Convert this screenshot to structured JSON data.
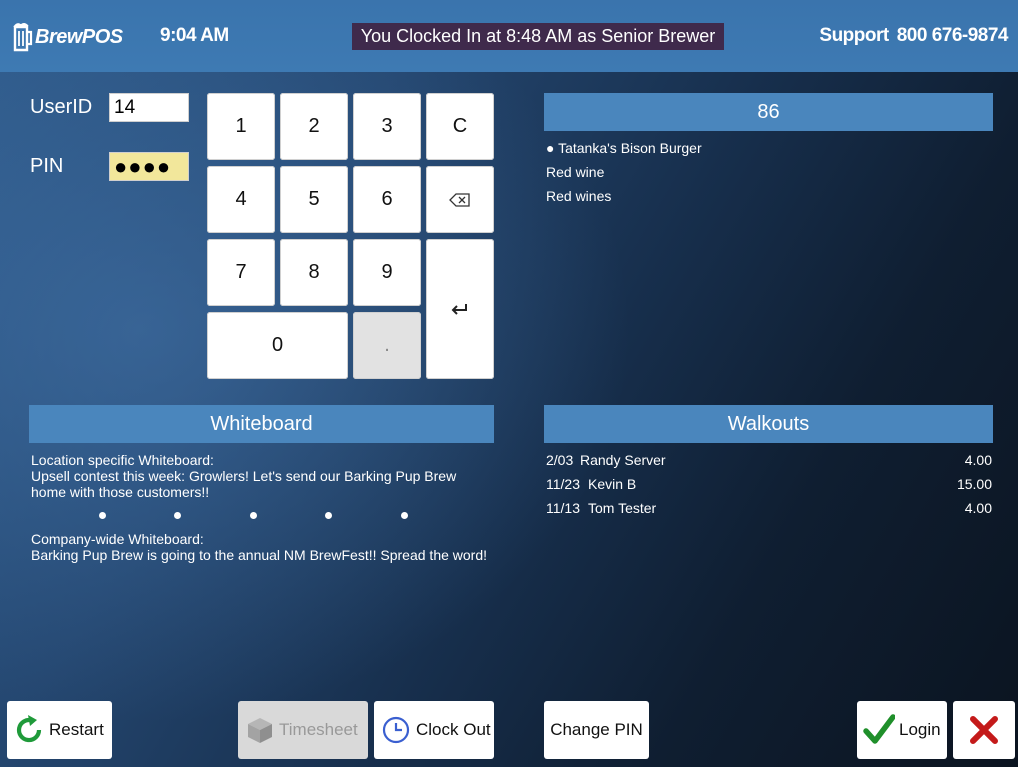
{
  "header": {
    "logo_text": "BrewPOS",
    "time": "9:04 AM",
    "clock_status": "You Clocked In at 8:48 AM as Senior Brewer",
    "support_label": "Support",
    "support_phone": "800 676-9874"
  },
  "login": {
    "userid_label": "UserID",
    "userid_value": "14",
    "pin_label": "PIN",
    "pin_value": "●●●●"
  },
  "keypad": {
    "k1": "1",
    "k2": "2",
    "k3": "3",
    "clear": "C",
    "k4": "4",
    "k5": "5",
    "k6": "6",
    "k7": "7",
    "k8": "8",
    "k9": "9",
    "k0": "0",
    "dot": "."
  },
  "eighty_six": {
    "title": "86",
    "items": [
      "● Tatanka's Bison Burger",
      "Red wine",
      "Red wines"
    ]
  },
  "whiteboard": {
    "title": "Whiteboard",
    "location_heading": "Location specific Whiteboard:",
    "location_message": "Upsell contest this week: Growlers! Let's send our Barking Pup Brew home with those customers!!",
    "company_heading": "Company-wide Whiteboard:",
    "company_message": "Barking Pup Brew is going to the annual NM BrewFest!! Spread the word!"
  },
  "walkouts": {
    "title": "Walkouts",
    "rows": [
      {
        "date": "2/03",
        "name": "Randy Server",
        "amount": "4.00"
      },
      {
        "date": "11/23",
        "name": "Kevin B",
        "amount": "15.00"
      },
      {
        "date": "11/13",
        "name": "Tom Tester",
        "amount": "4.00"
      }
    ]
  },
  "buttons": {
    "restart": "Restart",
    "timesheet": "Timesheet",
    "clock_out": "Clock Out",
    "change_pin": "Change PIN",
    "login": "Login"
  },
  "colors": {
    "header_bg": "#3e7ab3",
    "panel_head": "#4a86bd",
    "clockin_bg": "#3f2a4c",
    "pin_bg": "#f2e79b",
    "restart_green": "#1f9a3a",
    "clockout_blue": "#3a5fd0",
    "login_check": "#1f8f2a",
    "cancel_red": "#c41a1a"
  }
}
